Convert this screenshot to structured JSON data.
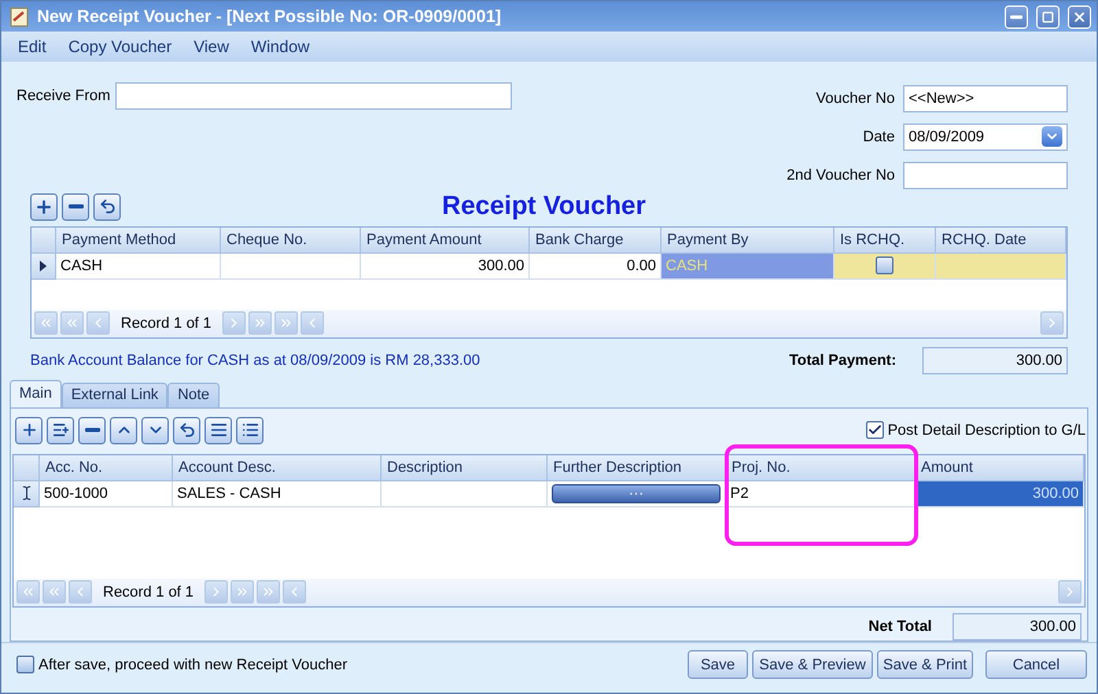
{
  "window": {
    "title": "New Receipt Voucher - [Next Possible No: OR-0909/0001]"
  },
  "menu": [
    "Edit",
    "Copy Voucher",
    "View",
    "Window"
  ],
  "receive_from": {
    "label": "Receive From"
  },
  "fields": [
    {
      "label": "Voucher No",
      "value": "<<New>>",
      "kind": "text"
    },
    {
      "label": "Date",
      "value": "08/09/2009",
      "kind": "date"
    },
    {
      "label": "2nd Voucher No",
      "kind": "text"
    }
  ],
  "payment": {
    "title": "Receipt Voucher",
    "record_label": "Record 1 of 1",
    "columns": [
      {
        "label": "Payment Method",
        "kind": "text"
      },
      {
        "label": "Cheque No.",
        "kind": "text"
      },
      {
        "label": "Payment Amount",
        "kind": "number"
      },
      {
        "label": "Bank Charge",
        "kind": "number"
      },
      {
        "label": "Payment By",
        "kind": "readonly"
      },
      {
        "label": "Is RCHQ.",
        "kind": "check"
      },
      {
        "label": "RCHQ. Date",
        "kind": "date"
      }
    ],
    "rows": [
      {
        "selected": true,
        "cells": [
          {
            "text": "CASH",
            "selected": false
          },
          {
            "selected": false
          },
          {
            "text": "300.00",
            "selected": false
          },
          {
            "text": "0.00",
            "selected": false
          },
          {
            "text": "CASH",
            "selected": false
          },
          {
            "checked": false,
            "selected": false
          },
          {
            "selected": false
          }
        ]
      }
    ]
  },
  "balance_note": "Bank Account Balance for CASH as at 08/09/2009 is RM 28,333.00",
  "total_payment": {
    "label": "Total Payment:",
    "value": "300.00"
  },
  "tabs": [
    {
      "label": "Main",
      "selected": true
    },
    {
      "label": "External Link",
      "selected": false
    },
    {
      "label": "Note",
      "selected": false
    }
  ],
  "post_detail": {
    "label": "Post Detail Description to G/L",
    "checked": true
  },
  "details": {
    "record_label": "Record 1 of 1",
    "columns": [
      {
        "label": "Acc. No.",
        "kind": "text"
      },
      {
        "label": "Account Desc.",
        "kind": "text"
      },
      {
        "label": "Description",
        "kind": "text"
      },
      {
        "label": "Further Description",
        "kind": "button"
      },
      {
        "label": "Proj. No.",
        "kind": "text"
      },
      {
        "label": "Amount",
        "kind": "number"
      }
    ],
    "rows": [
      {
        "editing": true,
        "cells": [
          {
            "text": "500-1000",
            "selected": false
          },
          {
            "text": "SALES - CASH",
            "selected": false
          },
          {
            "selected": false
          },
          {
            "text": "···",
            "selected": false
          },
          {
            "text": "P2",
            "selected": false
          },
          {
            "text": "300.00",
            "selected": true
          }
        ]
      }
    ]
  },
  "net_total": {
    "label": "Net Total",
    "value": "300.00"
  },
  "after_save": {
    "label": "After save, proceed with new Receipt Voucher",
    "checked": false
  },
  "buttons": [
    "Save",
    "Save & Preview",
    "Save & Print",
    "Cancel"
  ]
}
